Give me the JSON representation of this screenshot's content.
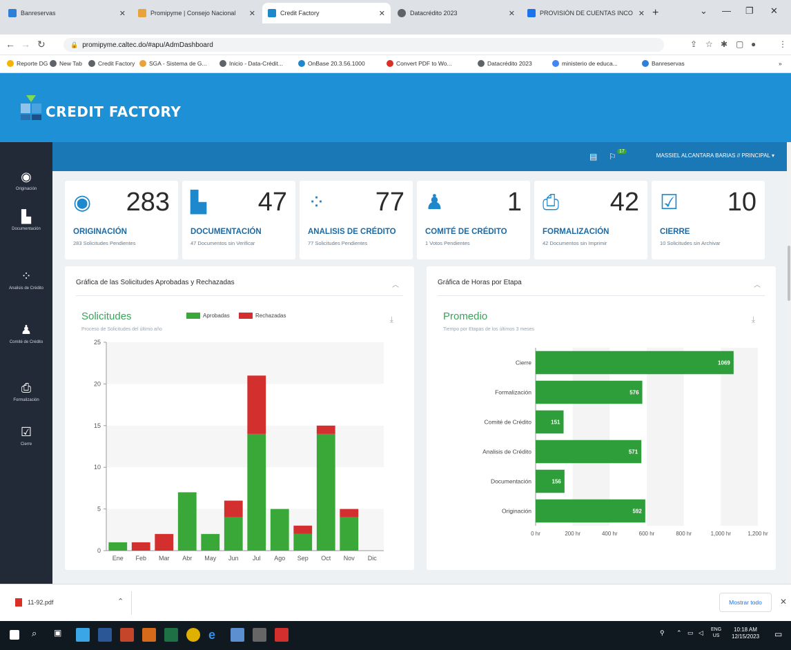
{
  "browser": {
    "tabs": [
      {
        "title": "Banreservas",
        "icon_color": "#2f7fd6",
        "active": false
      },
      {
        "title": "Promipyme | Consejo Nacional",
        "icon_color": "#e8a33b",
        "active": false
      },
      {
        "title": "Credit Factory",
        "icon_color": "#1e88cc",
        "active": true
      },
      {
        "title": "Datacrédito 2023",
        "icon_color": "#5f6368",
        "active": false
      },
      {
        "title": "PROVISIÓN DE CUENTAS INCO",
        "icon_color": "#1a73e8",
        "active": false
      }
    ],
    "url": "promipyme.caltec.do/#apu/AdmDashboard",
    "bookmarks": [
      {
        "label": "Reporte DG",
        "color": "#f4b400"
      },
      {
        "label": "New Tab",
        "color": "#5f6368"
      },
      {
        "label": "Credit Factory",
        "color": "#5f6368"
      },
      {
        "label": "SGA - Sistema de G...",
        "color": "#e8a33b"
      },
      {
        "label": "Inicio - Data-Crédit...",
        "color": "#5f6368"
      },
      {
        "label": "OnBase 20.3.56.1000",
        "color": "#1e88cc"
      },
      {
        "label": "Convert PDF to Wo...",
        "color": "#d93025"
      },
      {
        "label": "Datacrédito 2023",
        "color": "#5f6368"
      },
      {
        "label": "ministerio de educa...",
        "color": "#4285f4"
      },
      {
        "label": "Banreservas",
        "color": "#2f7fd6"
      }
    ]
  },
  "app": {
    "brand": "CREDIT FACTORY",
    "user": "MASSIEL ALCANTARA BARIAS // PRINCIPAL",
    "notification_count": "17"
  },
  "sidebar": {
    "items": [
      {
        "label": "Originación",
        "icon": "target-icon",
        "glyph": "◉"
      },
      {
        "label": "Documentación",
        "icon": "document-icon",
        "glyph": "▙"
      },
      {
        "label": "Analisis de Crédito",
        "icon": "spinner-icon",
        "glyph": "⁘"
      },
      {
        "label": "Comité de Crédito",
        "icon": "users-icon",
        "glyph": "♟"
      },
      {
        "label": "Formalización",
        "icon": "printer-icon",
        "glyph": "⎙"
      },
      {
        "label": "Cierre",
        "icon": "checkbox-icon",
        "glyph": "☑"
      }
    ]
  },
  "stats": [
    {
      "count": "283",
      "title": "ORIGINACIÓN",
      "sub": "283 Solicitudes Pendientes",
      "glyph": "◉",
      "icon": "target-icon"
    },
    {
      "count": "47",
      "title": "DOCUMENTACIÓN",
      "sub": "47 Documentos sin Verificar",
      "glyph": "▙",
      "icon": "document-icon"
    },
    {
      "count": "77",
      "title": "ANALISIS DE CRÉDITO",
      "sub": "77 Solicitudes Pendientes",
      "glyph": "⁘",
      "icon": "spinner-icon"
    },
    {
      "count": "1",
      "title": "COMITÉ DE CRÉDITO",
      "sub": "1 Votos Pendientes",
      "glyph": "♟",
      "icon": "users-icon"
    },
    {
      "count": "42",
      "title": "FORMALIZACIÓN",
      "sub": "42 Documentos sin Imprimir",
      "glyph": "⎙",
      "icon": "printer-icon"
    },
    {
      "count": "10",
      "title": "CIERRE",
      "sub": "10 Solicitudes sin Archivar",
      "glyph": "☑",
      "icon": "checkbox-icon"
    }
  ],
  "panels": {
    "left": {
      "header": "Gráfica de las Solicitudes Aprobadas y Rechazadas",
      "chart_title": "Solicitudes",
      "chart_subtitle": "Proceso de Solicitudes del último año",
      "legend": [
        "Aprobadas",
        "Rechazadas"
      ]
    },
    "right": {
      "header": "Gráfica de Horas por Etapa",
      "chart_title": "Promedio",
      "chart_subtitle": "Tiempo por Etapas de los últimos 3 meses"
    }
  },
  "chart_data": [
    {
      "type": "bar",
      "stacked": true,
      "title": "Solicitudes",
      "subtitle": "Proceso de Solicitudes del último año",
      "categories": [
        "Ene",
        "Feb",
        "Mar",
        "Abr",
        "May",
        "Jun",
        "Jul",
        "Ago",
        "Sep",
        "Oct",
        "Nov",
        "Dic"
      ],
      "series": [
        {
          "name": "Aprobadas",
          "color": "#3aa838",
          "values": [
            1,
            0,
            0,
            7,
            2,
            4,
            14,
            5,
            2,
            14,
            4,
            0
          ]
        },
        {
          "name": "Rechazadas",
          "color": "#d32f2f",
          "values": [
            0,
            1,
            2,
            0,
            0,
            2,
            7,
            0,
            1,
            1,
            1,
            0
          ]
        }
      ],
      "ylim": [
        0,
        25
      ],
      "yticks": [
        0,
        5,
        10,
        15,
        20,
        25
      ],
      "grid": true,
      "legend": "top"
    },
    {
      "type": "bar",
      "orientation": "horizontal",
      "title": "Promedio",
      "subtitle": "Tiempo por Etapas de los últimos 3 meses",
      "categories": [
        "Cierre",
        "Formalización",
        "Comité de Crédito",
        "Analisis de Crédito",
        "Documentación",
        "Originación"
      ],
      "values": [
        1069,
        576,
        151,
        571,
        156,
        592
      ],
      "labels": [
        "1069",
        "576",
        "151",
        "571",
        "156",
        "592"
      ],
      "color": "#2e9e3a",
      "xlim": [
        0,
        1200
      ],
      "xticks": [
        "0 hr",
        "200 hr",
        "400 hr",
        "600 hr",
        "800 hr",
        "1,000 hr",
        "1,200 hr"
      ],
      "grid": true
    }
  ],
  "downloads": {
    "file": "11-92.pdf",
    "show_all": "Mostrar todo"
  },
  "taskbar": {
    "lang": "ENG",
    "region": "US",
    "time": "10:18 AM",
    "date": "12/15/2023"
  }
}
